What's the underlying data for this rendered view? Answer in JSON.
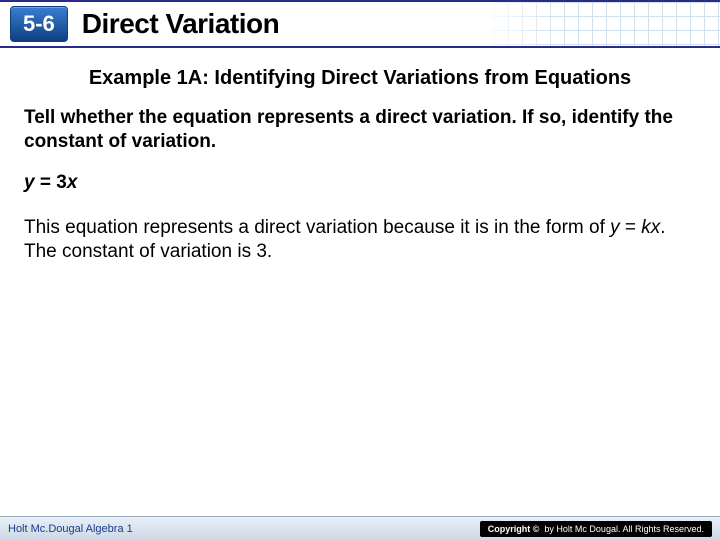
{
  "header": {
    "lesson_number": "5-6",
    "chapter_title": "Direct Variation"
  },
  "content": {
    "example_heading": "Example 1A: Identifying Direct Variations from Equations",
    "prompt": "Tell whether the equation represents a direct variation. If so, identify the constant of variation.",
    "equation_y": "y",
    "equation_eq": " = ",
    "equation_coef": "3",
    "equation_x": "x",
    "explanation_pre": "This equation represents a direct variation because it is in the form of ",
    "explanation_form_y": "y",
    "explanation_form_eq": " = ",
    "explanation_form_k": "kx",
    "explanation_post": ". The constant of variation is 3."
  },
  "footer": {
    "left": "Holt Mc.Dougal Algebra 1",
    "copyright_label": "Copyright ©",
    "copyright_text": "by Holt Mc Dougal. All Rights Reserved."
  }
}
